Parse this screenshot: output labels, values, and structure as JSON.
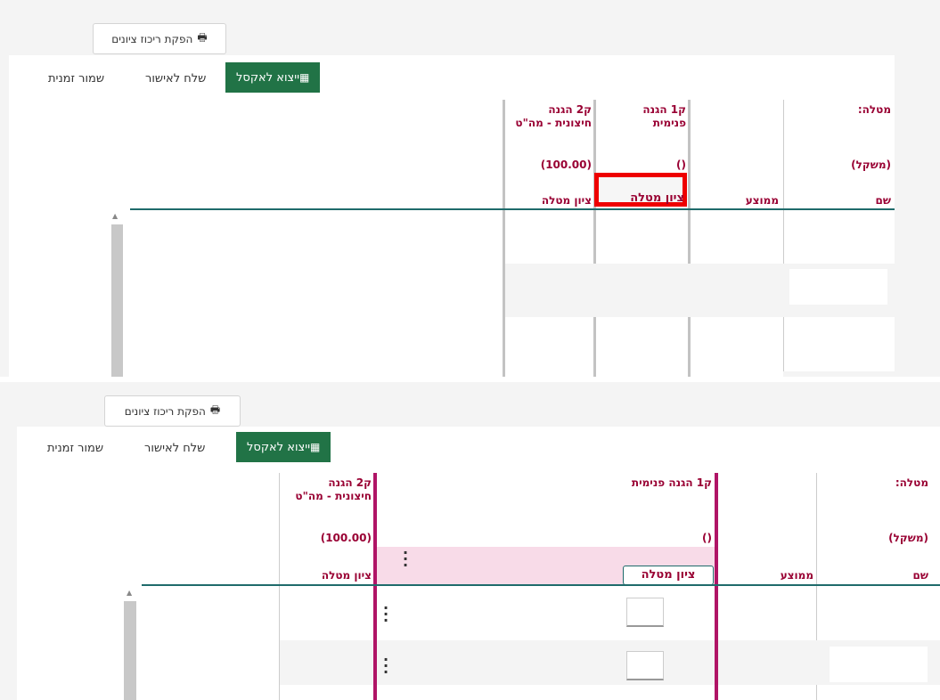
{
  "print_button": "הפקת ריכוז ציונים",
  "toolbar": {
    "save_temp": "שמור זמנית",
    "send_approval": "שלח לאישור",
    "export_excel": "ייצוא לאקסל"
  },
  "table": {
    "task_label": "מטלה:",
    "weight_label": "(משקל)",
    "name_col": "שם",
    "avg_col": "ממוצע",
    "q1_title": "ק1 הגנה פנימית",
    "q1_title_line1": "ק1 הגנה",
    "q1_title_line2": "פנימית",
    "q1_weight": "()",
    "q1_score": "ציון מטלה",
    "q2_title_line1": "ק2 הגנה",
    "q2_title_line2": "חיצונית - מה\"ט",
    "q2_weight": "(100.00)",
    "q2_score": "ציון מטלה"
  },
  "colors": {
    "excel_green": "#217346",
    "header_text": "#990033",
    "table_line": "#1f6b6b",
    "highlight_red": "#ee0000",
    "pink_border": "#b01466",
    "pink_fill": "#f8dbe8"
  },
  "icons": [
    "print-icon",
    "grid-icon",
    "kebab-icon",
    "scroll-up-arrow-icon"
  ]
}
